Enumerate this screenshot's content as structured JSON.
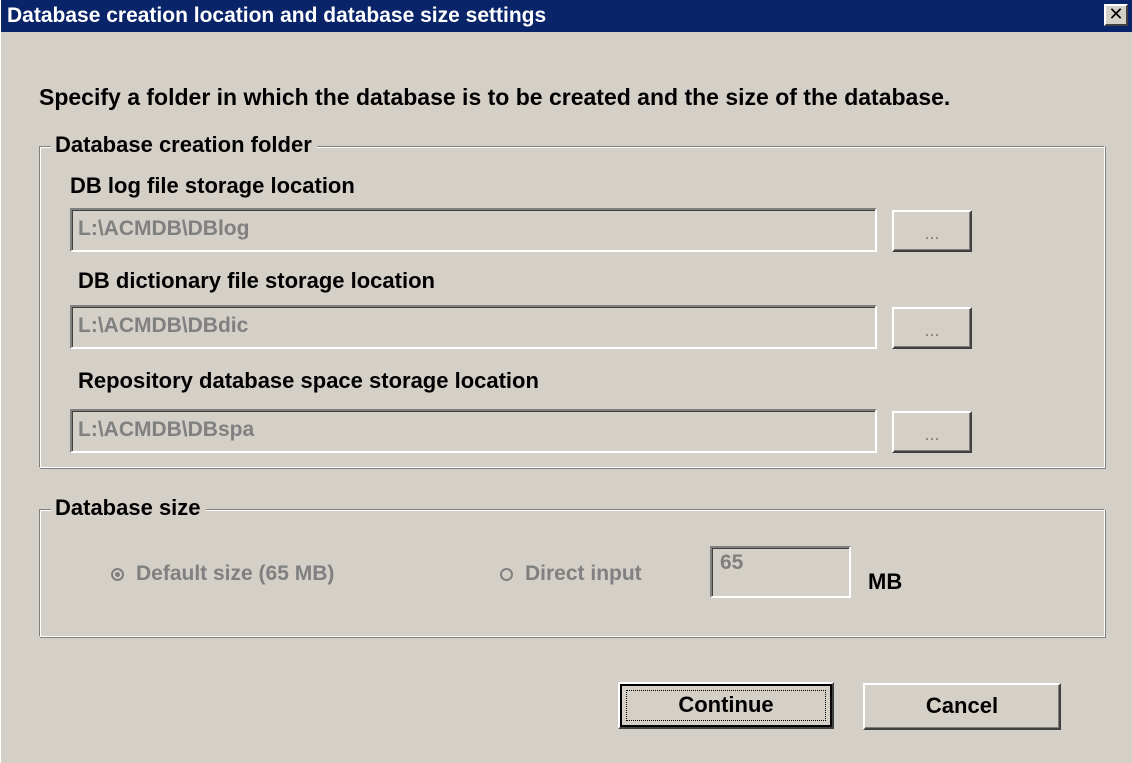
{
  "window": {
    "title": "Database creation location and database size settings",
    "close_label": "✕"
  },
  "instruction": "Specify a folder in which the database is to be created and the size of the database.",
  "creation_folder": {
    "title": "Database creation folder",
    "fields": [
      {
        "label": "DB log file storage location",
        "value": "L:\\ACMDB\\DBlog",
        "button": "..."
      },
      {
        "label": "DB dictionary file storage location",
        "value": "L:\\ACMDB\\DBdic",
        "button": "..."
      },
      {
        "label": "Repository database space storage location",
        "value": "L:\\ACMDB\\DBspa",
        "button": "..."
      }
    ]
  },
  "database_size": {
    "title": "Database size",
    "default_option": "Default size (65 MB)",
    "direct_option": "Direct input",
    "direct_value": "65",
    "unit": "MB",
    "selected": "default"
  },
  "buttons": {
    "continue": "Continue",
    "cancel": "Cancel"
  }
}
